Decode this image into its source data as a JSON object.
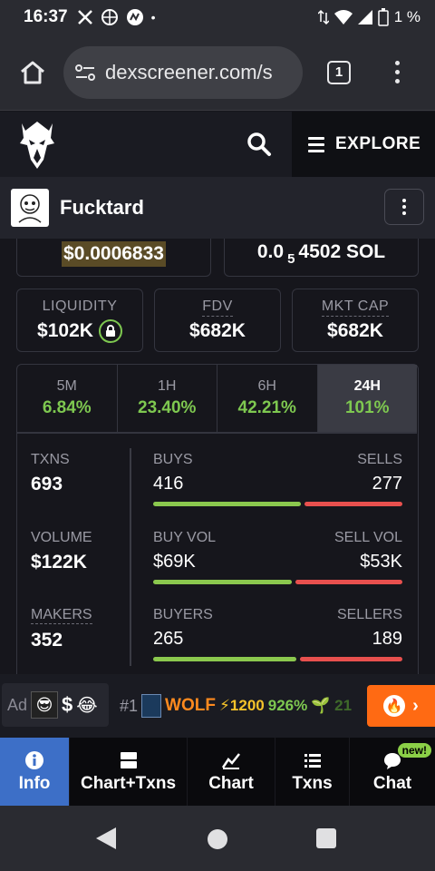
{
  "status_bar": {
    "time": "16:37",
    "battery": "1 %",
    "icons": [
      "x-icon",
      "globe-icon",
      "app-icon",
      "dot"
    ]
  },
  "browser": {
    "url": "dexscreener.com/s",
    "tab_count": "1"
  },
  "site": {
    "explore_label": "EXPLORE"
  },
  "token": {
    "name": "Fucktard",
    "price_usd": "$0.0006833",
    "price_sol_prefix": "0.0",
    "price_sol_sub": "5",
    "price_sol_rest": "4502 SOL"
  },
  "stats": {
    "liquidity_label": "LIQUIDITY",
    "liquidity_value": "$102K",
    "fdv_label": "FDV",
    "fdv_value": "$682K",
    "mktcap_label": "MKT CAP",
    "mktcap_value": "$682K"
  },
  "timeframes": [
    {
      "label": "5M",
      "value": "6.84%"
    },
    {
      "label": "1H",
      "value": "23.40%"
    },
    {
      "label": "6H",
      "value": "42.21%"
    },
    {
      "label": "24H",
      "value": "101%"
    }
  ],
  "metrics": {
    "txns_label": "TXNS",
    "txns_value": "693",
    "volume_label": "VOLUME",
    "volume_value": "$122K",
    "makers_label": "MAKERS",
    "makers_value": "352",
    "buys_label": "BUYS",
    "buys_value": "416",
    "sells_label": "SELLS",
    "sells_value": "277",
    "buyvol_label": "BUY VOL",
    "buyvol_value": "$69K",
    "sellvol_label": "SELL VOL",
    "sellvol_value": "$53K",
    "buyers_label": "BUYERS",
    "buyers_value": "265",
    "sellers_label": "SELLERS",
    "sellers_value": "189",
    "buy_ratio_txns": 0.6,
    "buy_ratio_vol": 0.565,
    "buy_ratio_makers": 0.584
  },
  "ticker": {
    "ad_label": "Ad",
    "ad_dollar": "$",
    "rank": "#1",
    "name": "WOLF",
    "bolt_num": "⚡1200",
    "pct": "926%",
    "fade": "🌱 21"
  },
  "nav": {
    "info": "Info",
    "chart_txns": "Chart+Txns",
    "chart": "Chart",
    "txns": "Txns",
    "chat": "Chat",
    "new_badge": "new!"
  },
  "colors": {
    "positive": "#7ec850",
    "buy_bar": "#8bc84e",
    "sell_bar": "#e8504e",
    "active_nav": "#3d6fc7",
    "fire_button": "#ff6a13"
  }
}
